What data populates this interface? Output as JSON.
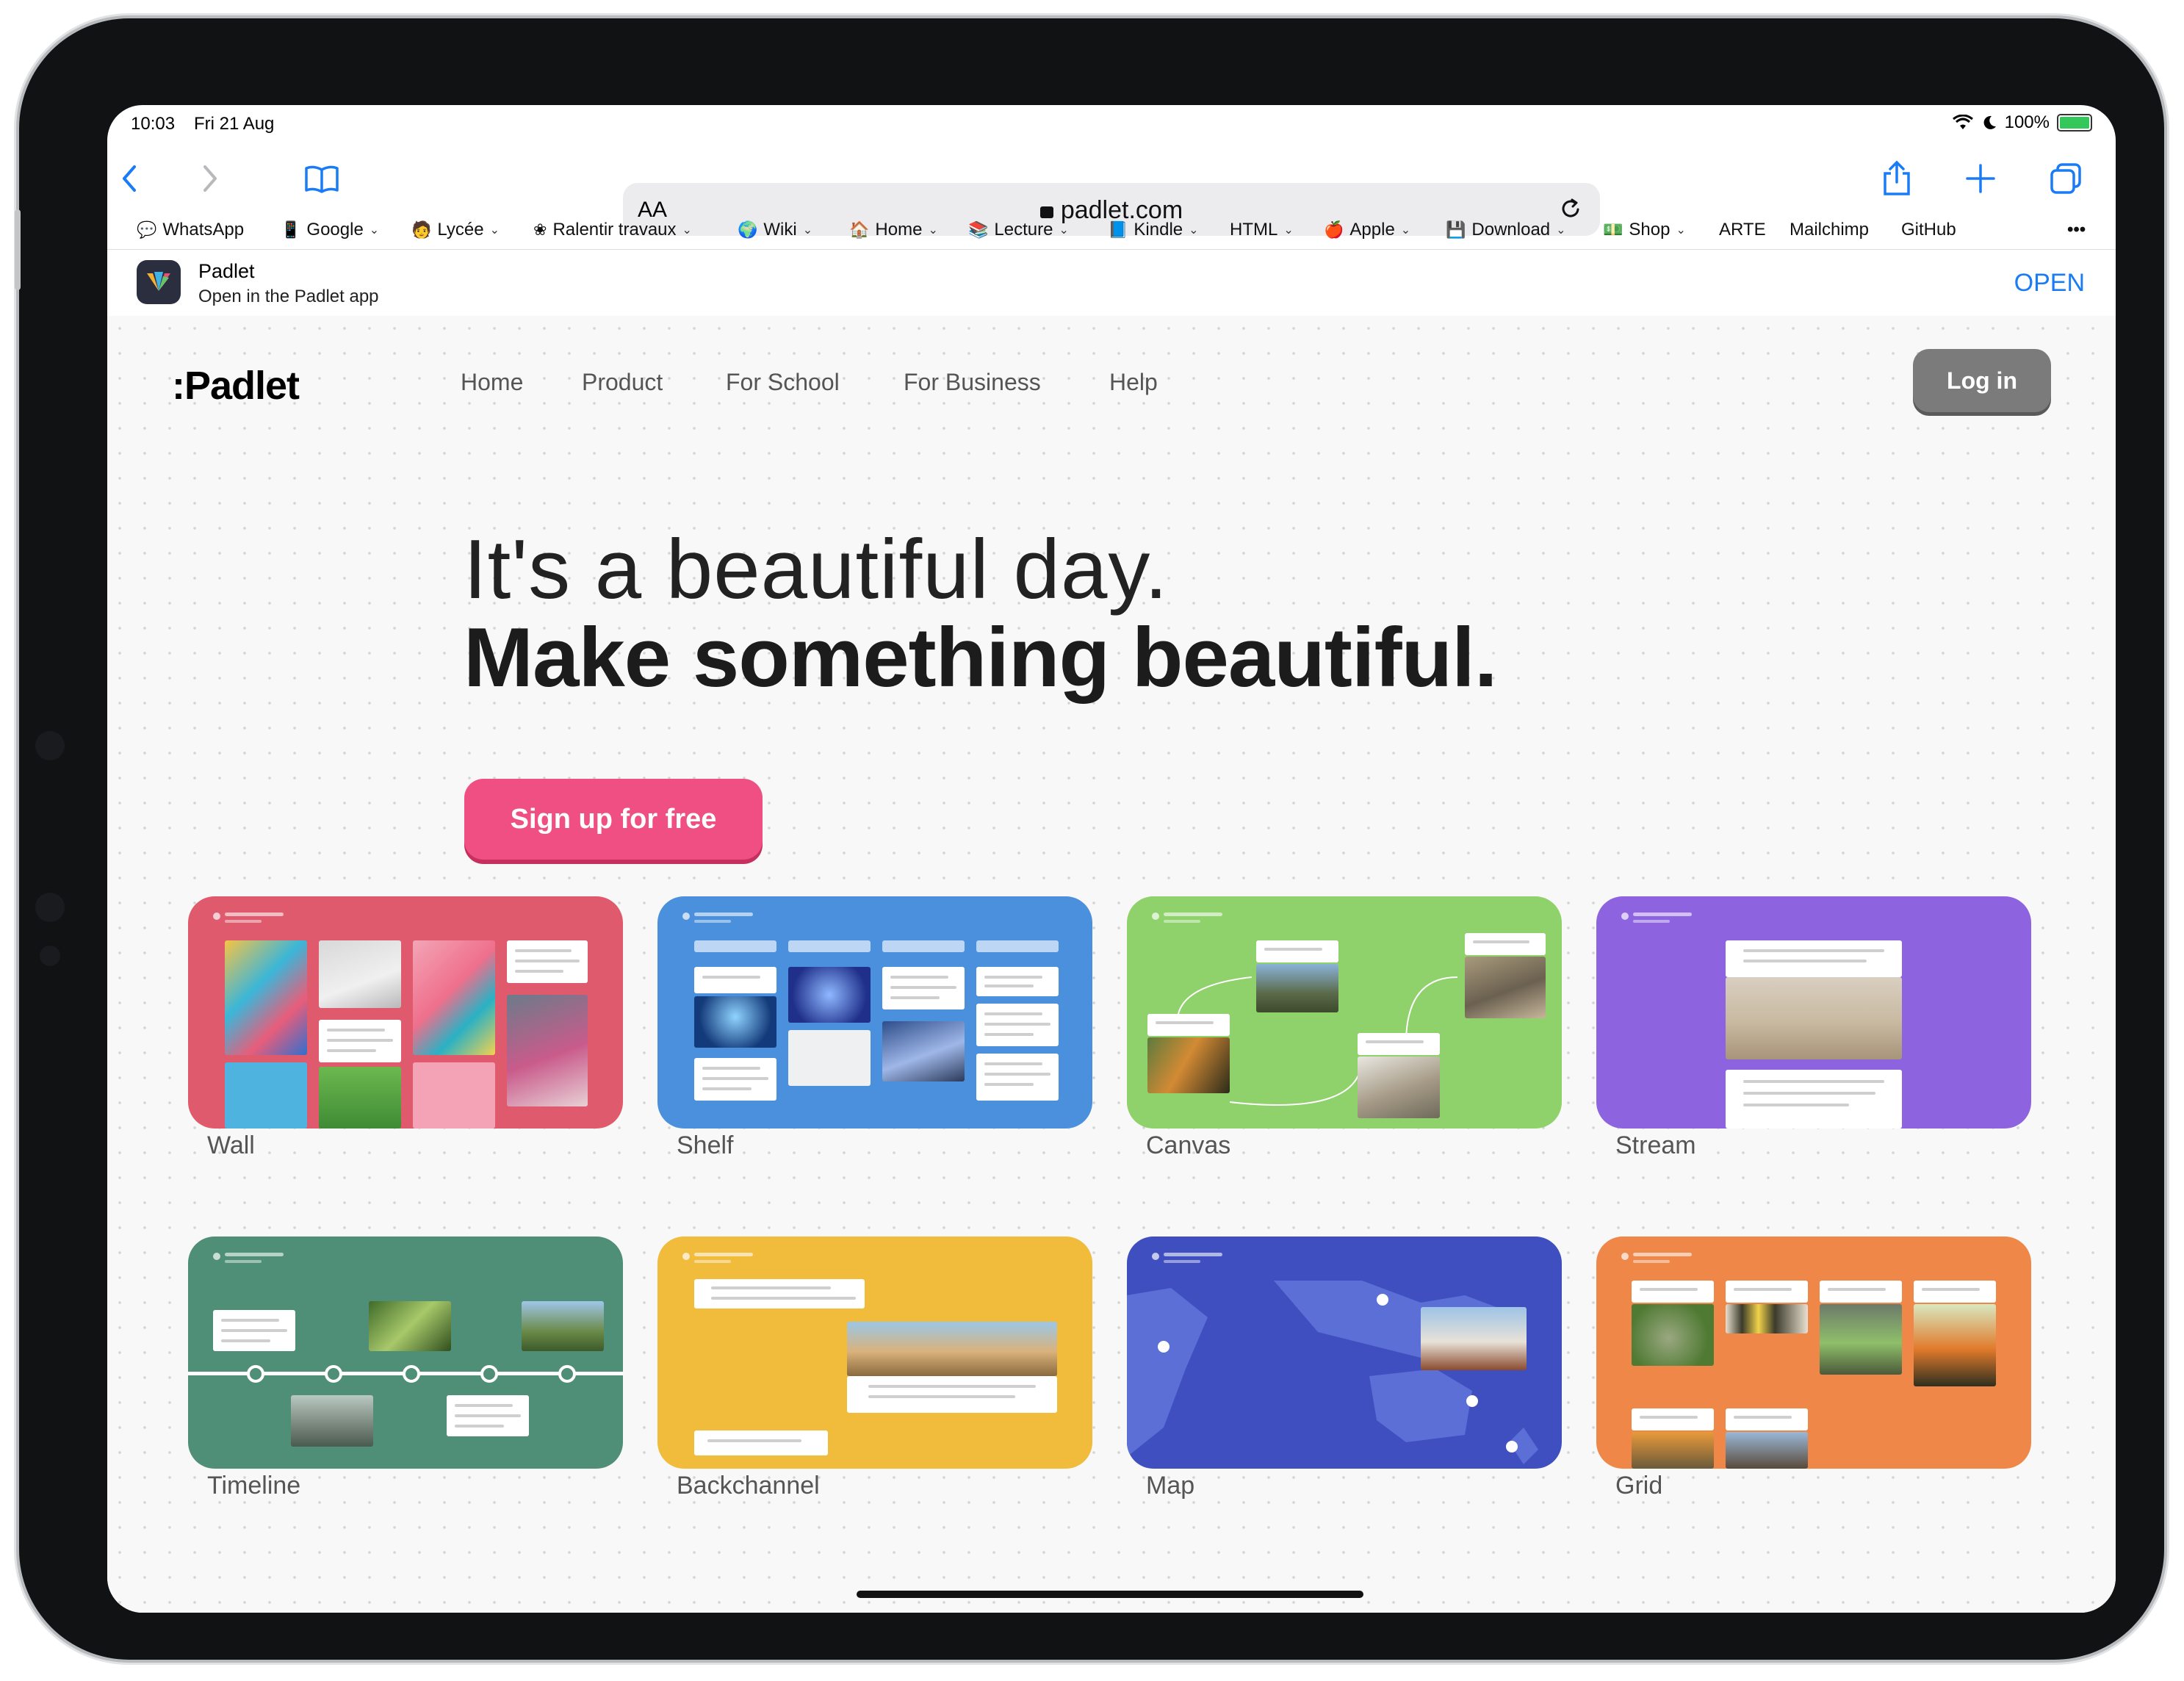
{
  "status_bar": {
    "time": "10:03",
    "date": "Fri 21 Aug",
    "battery": "100%"
  },
  "browser": {
    "url_text_size": "AA",
    "url": "padlet.com",
    "bookmarks": [
      {
        "label": "WhatsApp",
        "icon": "chat-icon",
        "dropdown": false
      },
      {
        "label": "Google",
        "icon": "phone-icon",
        "dropdown": true
      },
      {
        "label": "Lycée",
        "icon": "person-icon",
        "dropdown": true
      },
      {
        "label": "Ralentir travaux",
        "icon": "flower-icon",
        "dropdown": true
      },
      {
        "label": "Wiki",
        "icon": "globe-icon",
        "dropdown": true
      },
      {
        "label": "Home",
        "icon": "house-icon",
        "dropdown": true
      },
      {
        "label": "Lecture",
        "icon": "books-icon",
        "dropdown": true
      },
      {
        "label": "Kindle",
        "icon": "book-icon",
        "dropdown": true
      },
      {
        "label": "HTML",
        "icon": "",
        "dropdown": true
      },
      {
        "label": "Apple",
        "icon": "apple-icon",
        "dropdown": true
      },
      {
        "label": "Download",
        "icon": "floppy-icon",
        "dropdown": true
      },
      {
        "label": "Shop",
        "icon": "money-icon",
        "dropdown": true
      },
      {
        "label": "ARTE",
        "icon": "",
        "dropdown": false
      },
      {
        "label": "Mailchimp",
        "icon": "",
        "dropdown": false
      },
      {
        "label": "GitHub",
        "icon": "",
        "dropdown": false
      }
    ],
    "more_label": "•••"
  },
  "app_banner": {
    "title": "Padlet",
    "subtitle": "Open in the Padlet app",
    "open_label": "OPEN"
  },
  "site": {
    "logo": ":Padlet",
    "nav": [
      "Home",
      "Product",
      "For School",
      "For Business",
      "Help"
    ],
    "login_label": "Log in",
    "hero_line1": "It's a beautiful day.",
    "hero_line2": "Make something beautiful.",
    "signup_label": "Sign up for free",
    "formats": [
      {
        "label": "Wall",
        "color": "#e05a6d"
      },
      {
        "label": "Shelf",
        "color": "#4a90dd"
      },
      {
        "label": "Canvas",
        "color": "#8fd16a"
      },
      {
        "label": "Stream",
        "color": "#8d63e0"
      },
      {
        "label": "Timeline",
        "color": "#4f8f77"
      },
      {
        "label": "Backchannel",
        "color": "#f1bb3c"
      },
      {
        "label": "Map",
        "color": "#3f4fc0"
      },
      {
        "label": "Grid",
        "color": "#ee8748"
      }
    ]
  },
  "colors": {
    "accent": "#1a7cf5",
    "signup": "#ef4f83",
    "login": "#7b7b7b"
  }
}
